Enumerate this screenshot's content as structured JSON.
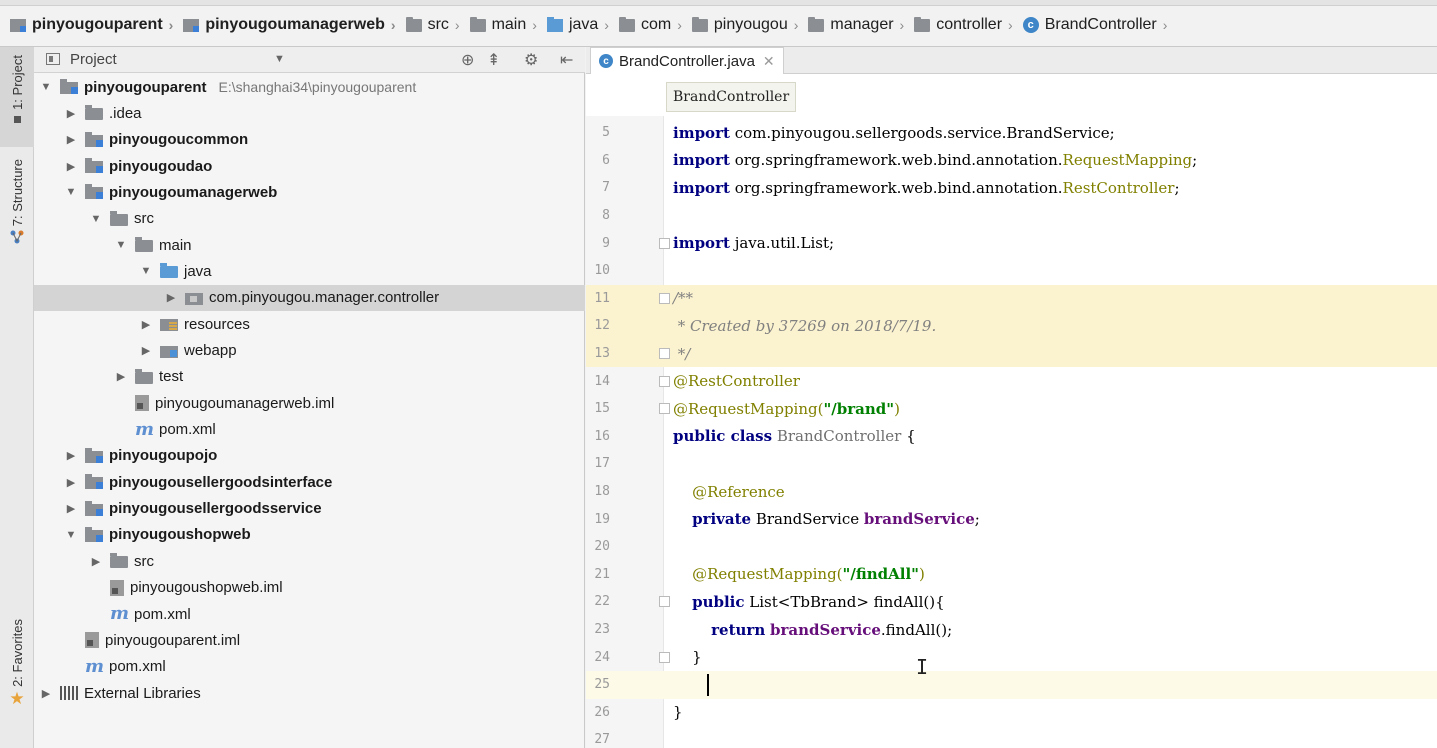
{
  "breadcrumb": {
    "items": [
      {
        "label": "pinyougouparent",
        "icon": "module-folder-icon",
        "bold": true
      },
      {
        "label": "pinyougoumanagerweb",
        "icon": "module-folder-icon",
        "bold": true
      },
      {
        "label": "src",
        "icon": "folder-icon"
      },
      {
        "label": "main",
        "icon": "folder-icon"
      },
      {
        "label": "java",
        "icon": "source-folder-icon"
      },
      {
        "label": "com",
        "icon": "package-icon"
      },
      {
        "label": "pinyougou",
        "icon": "package-icon"
      },
      {
        "label": "manager",
        "icon": "package-icon"
      },
      {
        "label": "controller",
        "icon": "package-icon"
      },
      {
        "label": "BrandController",
        "icon": "class-icon"
      }
    ]
  },
  "toolstrip": {
    "project_tab": "1: Project",
    "structure_tab": "7: Structure",
    "favorites_tab": "2: Favorites"
  },
  "project_panel": {
    "title": "Project",
    "tree": [
      {
        "label": "pinyougouparent",
        "path": "E:\\shanghai34\\pinyougouparent",
        "level": 0,
        "expanded": true,
        "icon": "module",
        "bold": true
      },
      {
        "label": ".idea",
        "level": 1,
        "expanded": false,
        "icon": "folder"
      },
      {
        "label": "pinyougoucommon",
        "level": 1,
        "expanded": false,
        "icon": "module",
        "bold": true
      },
      {
        "label": "pinyougoudao",
        "level": 1,
        "expanded": false,
        "icon": "module",
        "bold": true
      },
      {
        "label": "pinyougoumanagerweb",
        "level": 1,
        "expanded": true,
        "icon": "module",
        "bold": true
      },
      {
        "label": "src",
        "level": 2,
        "expanded": true,
        "icon": "folder"
      },
      {
        "label": "main",
        "level": 3,
        "expanded": true,
        "icon": "folder"
      },
      {
        "label": "java",
        "level": 4,
        "expanded": true,
        "icon": "folder-blue"
      },
      {
        "label": "com.pinyougou.manager.controller",
        "level": 5,
        "expanded": false,
        "icon": "pkg",
        "selected": true
      },
      {
        "label": "resources",
        "level": 4,
        "expanded": false,
        "icon": "res"
      },
      {
        "label": "webapp",
        "level": 4,
        "expanded": false,
        "icon": "web"
      },
      {
        "label": "test",
        "level": 3,
        "expanded": false,
        "icon": "folder"
      },
      {
        "label": "pinyougoumanagerweb.iml",
        "level": 3,
        "icon": "iml"
      },
      {
        "label": "pom.xml",
        "level": 3,
        "icon": "maven"
      },
      {
        "label": "pinyougoupojo",
        "level": 1,
        "expanded": false,
        "icon": "module",
        "bold": true
      },
      {
        "label": "pinyougousellergoodsinterface",
        "level": 1,
        "expanded": false,
        "icon": "module",
        "bold": true
      },
      {
        "label": "pinyougousellergoodsservice",
        "level": 1,
        "expanded": false,
        "icon": "module",
        "bold": true
      },
      {
        "label": "pinyougoushopweb",
        "level": 1,
        "expanded": true,
        "icon": "module",
        "bold": true
      },
      {
        "label": "src",
        "level": 2,
        "expanded": false,
        "icon": "folder"
      },
      {
        "label": "pinyougoushopweb.iml",
        "level": 2,
        "icon": "iml"
      },
      {
        "label": "pom.xml",
        "level": 2,
        "icon": "maven"
      },
      {
        "label": "pinyougouparent.iml",
        "level": 1,
        "icon": "iml"
      },
      {
        "label": "pom.xml",
        "level": 1,
        "icon": "maven"
      },
      {
        "label": "External Libraries",
        "level": 0,
        "expanded": false,
        "icon": "libs"
      }
    ]
  },
  "editor": {
    "tab_label": "BrandController.java",
    "scope_label": "BrandController",
    "lines": [
      {
        "n": "5",
        "parts": [
          [
            "kw",
            "import"
          ],
          [
            "",
            "com.pinyougou.sellergoods.service.BrandService;"
          ]
        ]
      },
      {
        "n": "6",
        "parts": [
          [
            "kw",
            "import"
          ],
          [
            "",
            "org.springframework.web.bind.annotation."
          ],
          [
            "ann",
            "RequestMapping"
          ],
          [
            "",
            ";"
          ]
        ]
      },
      {
        "n": "7",
        "parts": [
          [
            "kw",
            "import"
          ],
          [
            "",
            "org.springframework.web.bind.annotation."
          ],
          [
            "ann",
            "RestController"
          ],
          [
            "",
            ";"
          ]
        ]
      },
      {
        "n": "8",
        "parts": []
      },
      {
        "n": "9",
        "parts": [
          [
            "kw",
            "import"
          ],
          [
            "",
            "java.util.List;"
          ]
        ],
        "fold": true
      },
      {
        "n": "10",
        "parts": []
      },
      {
        "n": "11",
        "parts": [
          [
            "cm",
            "/**"
          ]
        ],
        "fold": true,
        "doc": true
      },
      {
        "n": "12",
        "parts": [
          [
            "cm",
            " * Created by 37269 on 2018/7/19."
          ]
        ],
        "doc": true
      },
      {
        "n": "13",
        "parts": [
          [
            "cm",
            " */"
          ]
        ],
        "fold": true,
        "doc": true
      },
      {
        "n": "14",
        "parts": [
          [
            "ann",
            "@RestController"
          ]
        ],
        "fold": true
      },
      {
        "n": "15",
        "parts": [
          [
            "ann",
            "@RequestMapping("
          ],
          [
            "str",
            "\"/brand\""
          ],
          [
            "ann",
            ")"
          ]
        ],
        "fold": true
      },
      {
        "n": "16",
        "parts": [
          [
            "kw",
            "public class"
          ],
          [
            "grayname",
            "BrandController"
          ],
          [
            "",
            " {"
          ]
        ]
      },
      {
        "n": "17",
        "parts": []
      },
      {
        "n": "18",
        "parts": [
          [
            "",
            "    "
          ],
          [
            "ann",
            "@Reference"
          ]
        ]
      },
      {
        "n": "19",
        "parts": [
          [
            "",
            "    "
          ],
          [
            "kw",
            "private"
          ],
          [
            "",
            "BrandService "
          ],
          [
            "fld",
            "brandService"
          ],
          [
            "",
            ";"
          ]
        ]
      },
      {
        "n": "20",
        "parts": []
      },
      {
        "n": "21",
        "parts": [
          [
            "",
            "    "
          ],
          [
            "ann",
            "@RequestMapping("
          ],
          [
            "str",
            "\"/findAll\""
          ],
          [
            "ann",
            ")"
          ]
        ]
      },
      {
        "n": "22",
        "parts": [
          [
            "",
            "    "
          ],
          [
            "kw",
            "public"
          ],
          [
            "",
            "List<TbBrand> findAll(){"
          ]
        ],
        "fold": true
      },
      {
        "n": "23",
        "parts": [
          [
            "",
            "        "
          ],
          [
            "kw",
            "return"
          ],
          [
            "fld",
            "brandService"
          ],
          [
            "",
            ".findAll();"
          ]
        ]
      },
      {
        "n": "24",
        "parts": [
          [
            "",
            "    }"
          ]
        ],
        "fold": true
      },
      {
        "n": "25",
        "parts": [],
        "current": true
      },
      {
        "n": "26",
        "parts": [
          [
            "",
            "}"
          ]
        ]
      },
      {
        "n": "27",
        "parts": []
      }
    ]
  }
}
